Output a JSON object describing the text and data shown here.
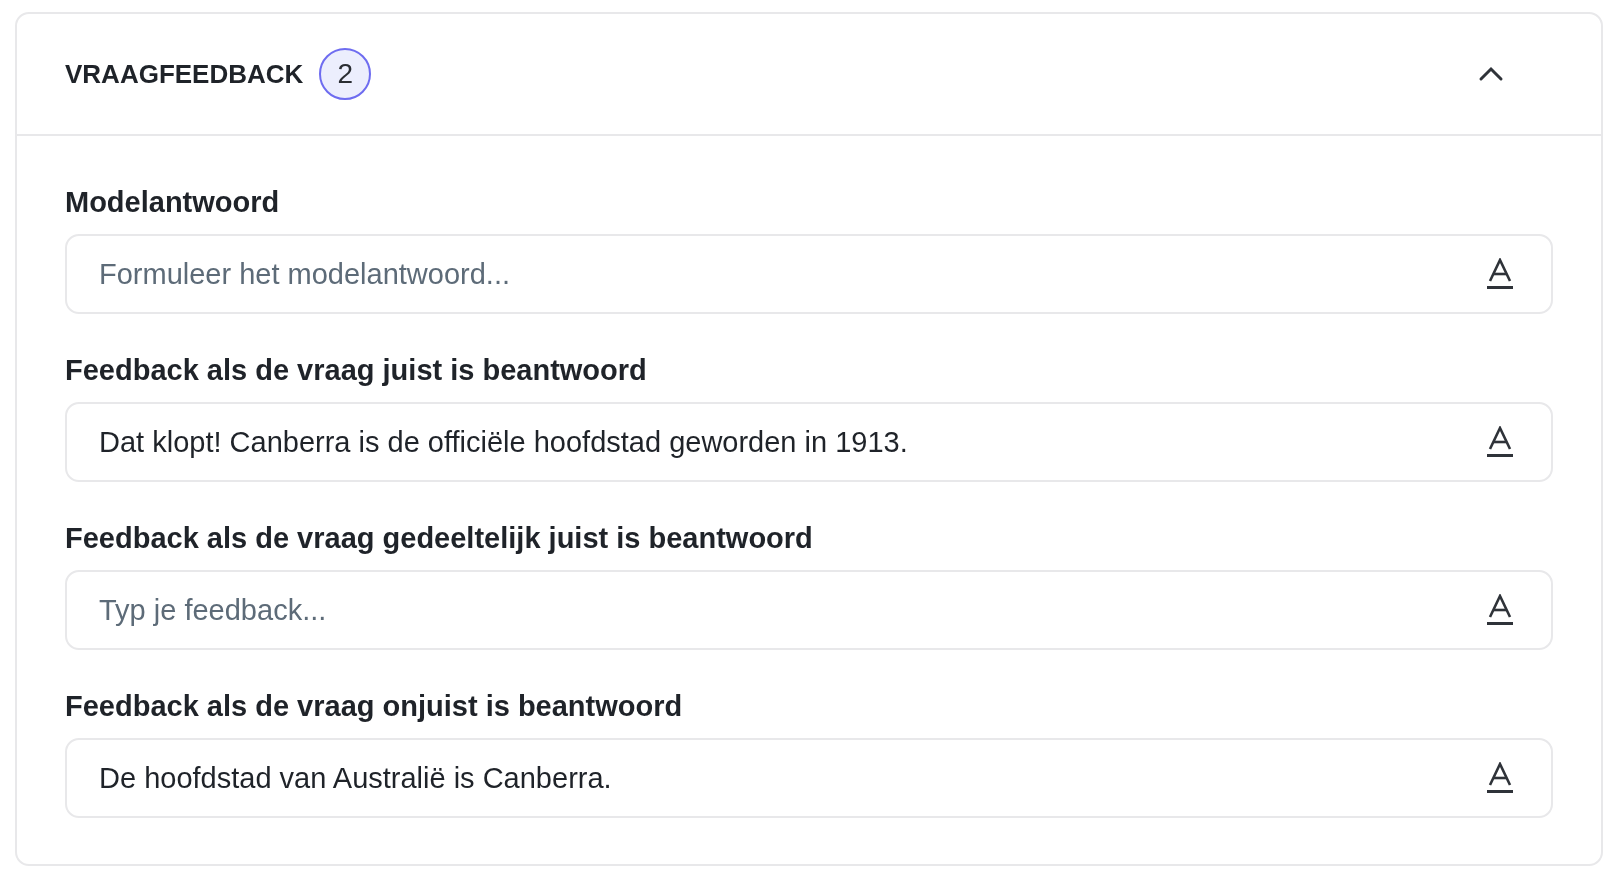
{
  "panel": {
    "title": "VRAAGFEEDBACK",
    "count": "2",
    "expanded": true
  },
  "fields": [
    {
      "label": "Modelantwoord",
      "placeholder": "Formuleer het modelantwoord..."
    },
    {
      "label": "Feedback als de vraag juist is beantwoord",
      "value": "Dat klopt! Canberra is de officiële hoofdstad geworden in 1913."
    },
    {
      "label": "Feedback als de vraag gedeeltelijk juist is beantwoord",
      "placeholder": "Typ je feedback..."
    },
    {
      "label": "Feedback als de vraag onjuist is beantwoord",
      "value": "De hoofdstad van Australië is Canberra."
    }
  ]
}
